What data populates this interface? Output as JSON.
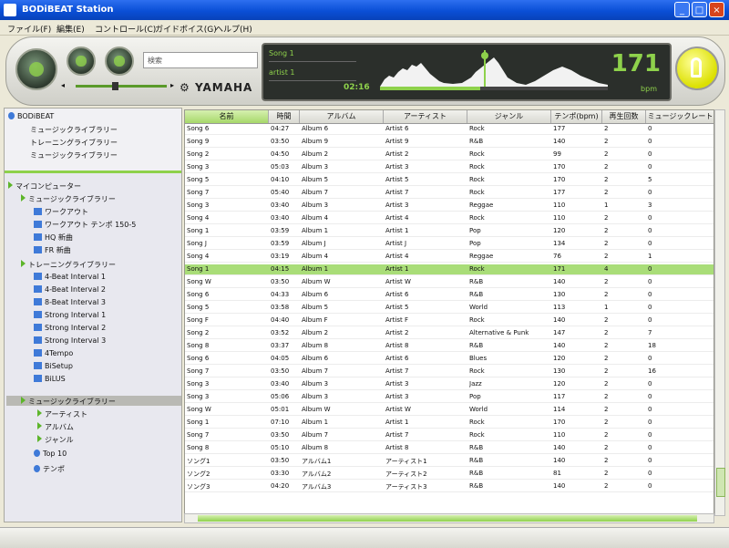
{
  "window": {
    "title": "BODiBEAT Station",
    "controls": [
      "_",
      "□",
      "×"
    ]
  },
  "menu": [
    "ファイル(F)",
    "編集(E)",
    "コントロール(C)",
    "ガイドボイス(G)",
    "ヘルプ(H)"
  ],
  "player": {
    "search_value": "検索",
    "volume_fraction": 0.45,
    "brand": "YAMAHA",
    "now_playing": {
      "song": "Song 1",
      "artist": "artist 1",
      "time": "02:16",
      "progress_fraction": 0.44
    },
    "tempo": "171",
    "tempo_unit": "bpm"
  },
  "sidebar": {
    "device": "BODiBEAT",
    "device_items": [
      "ミュージックライブラリー",
      "トレーニングライブラリー",
      "ミュージックライブラリー"
    ],
    "pc_root": "マイコンピューター",
    "music_lib": "ミュージックライブラリー",
    "music_lib_items": [
      "ワークアウト",
      "ワークアウト テンポ 150-5",
      "HQ 新曲",
      "FR 新曲"
    ],
    "training_lib": "トレーニングライブラリー",
    "training_lib_items": [
      "4-Beat Interval 1",
      "4-Beat Interval 2",
      "8-Beat Interval 3",
      "Strong Interval 1",
      "Strong Interval 2",
      "Strong Interval 3",
      "4Tempo",
      "BiSetup",
      "BiLUS"
    ],
    "music_lib2": "ミュージックライブラリー",
    "music_lib2_items": [
      "アーティスト",
      "アルバム",
      "ジャンル",
      "Top 10",
      "テンポ"
    ]
  },
  "table": {
    "columns": [
      "名前",
      "時間",
      "アルバム",
      "アーティスト",
      "ジャンル",
      "テンポ(bpm)",
      "再生回数",
      "ミュージックレート"
    ],
    "selected_row": 11,
    "rows": [
      [
        "Song 6",
        "04:27",
        "Album 6",
        "Artist 6",
        "Rock",
        "177",
        "2",
        "0"
      ],
      [
        "Song 9",
        "03:50",
        "Album 9",
        "Artist 9",
        "R&B",
        "140",
        "2",
        "0"
      ],
      [
        "Song 2",
        "04:50",
        "Album 2",
        "Artist 2",
        "Rock",
        "99",
        "2",
        "0"
      ],
      [
        "Song 3",
        "05:03",
        "Album 3",
        "Artist 3",
        "Rock",
        "170",
        "2",
        "0"
      ],
      [
        "Song 5",
        "04:10",
        "Album 5",
        "Artist 5",
        "Rock",
        "170",
        "2",
        "5"
      ],
      [
        "Song 7",
        "05:40",
        "Album 7",
        "Artist 7",
        "Rock",
        "177",
        "2",
        "0"
      ],
      [
        "Song 3",
        "03:40",
        "Album 3",
        "Artist 3",
        "Reggae",
        "110",
        "1",
        "3"
      ],
      [
        "Song 4",
        "03:40",
        "Album 4",
        "Artist 4",
        "Rock",
        "110",
        "2",
        "0"
      ],
      [
        "Song 1",
        "03:59",
        "Album 1",
        "Artist 1",
        "Pop",
        "120",
        "2",
        "0"
      ],
      [
        "Song J",
        "03:59",
        "Album J",
        "Artist J",
        "Pop",
        "134",
        "2",
        "0"
      ],
      [
        "Song 4",
        "03:19",
        "Album 4",
        "Artist 4",
        "Reggae",
        "76",
        "2",
        "1"
      ],
      [
        "Song 1",
        "04:15",
        "Album 1",
        "Artist 1",
        "Rock",
        "171",
        "4",
        "0"
      ],
      [
        "Song W",
        "03:50",
        "Album W",
        "Artist W",
        "R&B",
        "140",
        "2",
        "0"
      ],
      [
        "Song 6",
        "04:33",
        "Album 6",
        "Artist 6",
        "R&B",
        "130",
        "2",
        "0"
      ],
      [
        "Song 5",
        "03:58",
        "Album 5",
        "Artist 5",
        "World",
        "113",
        "1",
        "0"
      ],
      [
        "Song F",
        "04:40",
        "Album F",
        "Artist F",
        "Rock",
        "140",
        "2",
        "0"
      ],
      [
        "Song 2",
        "03:52",
        "Album 2",
        "Artist 2",
        "Alternative & Punk",
        "147",
        "2",
        "7"
      ],
      [
        "Song 8",
        "03:37",
        "Album 8",
        "Artist 8",
        "R&B",
        "140",
        "2",
        "18"
      ],
      [
        "Song 6",
        "04:05",
        "Album 6",
        "Artist 6",
        "Blues",
        "120",
        "2",
        "0"
      ],
      [
        "Song 7",
        "03:50",
        "Album 7",
        "Artist 7",
        "Rock",
        "130",
        "2",
        "16"
      ],
      [
        "Song 3",
        "03:40",
        "Album 3",
        "Artist 3",
        "Jazz",
        "120",
        "2",
        "0"
      ],
      [
        "Song 3",
        "05:06",
        "Album 3",
        "Artist 3",
        "Pop",
        "117",
        "2",
        "0"
      ],
      [
        "Song W",
        "05:01",
        "Album W",
        "Artist W",
        "World",
        "114",
        "2",
        "0"
      ],
      [
        "Song 1",
        "07:10",
        "Album 1",
        "Artist 1",
        "Rock",
        "170",
        "2",
        "0"
      ],
      [
        "Song 7",
        "03:50",
        "Album 7",
        "Artist 7",
        "Rock",
        "110",
        "2",
        "0"
      ],
      [
        "Song 8",
        "05:10",
        "Album 8",
        "Artist 8",
        "R&B",
        "140",
        "2",
        "0"
      ],
      [
        "ソング1",
        "03:50",
        "アルバム1",
        "アーティスト1",
        "R&B",
        "140",
        "2",
        "0"
      ],
      [
        "ソング2",
        "03:30",
        "アルバム2",
        "アーティスト2",
        "R&B",
        "81",
        "2",
        "0"
      ],
      [
        "ソング3",
        "04:20",
        "アルバム3",
        "アーティスト3",
        "R&B",
        "140",
        "2",
        "0"
      ]
    ]
  },
  "colors": {
    "accent": "#8ed14b",
    "selected_row": "#a9dd78",
    "display_bg": "#2b2f2b",
    "title_bar": "#0a4fd6"
  }
}
